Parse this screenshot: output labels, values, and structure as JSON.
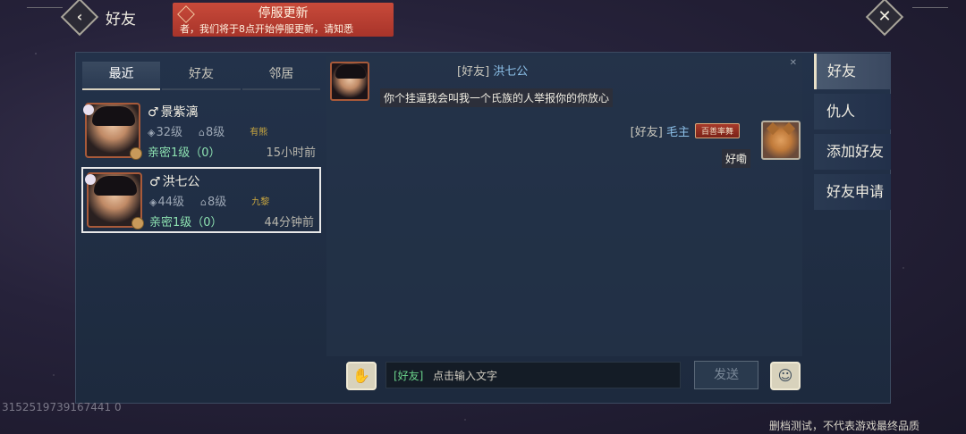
{
  "header": {
    "title": "好友"
  },
  "notice": {
    "title": "停服更新",
    "text": "者，我们将于8点开始停服更新，请知悉"
  },
  "tabs": [
    {
      "label": "最近"
    },
    {
      "label": "好友"
    },
    {
      "label": "邻居"
    }
  ],
  "friends": [
    {
      "name": "景紫漓",
      "gender": "♂",
      "level": "32级",
      "home_level": "8级",
      "badge": "有熊",
      "intimacy": "亲密1级（0）",
      "time": "15小时前"
    },
    {
      "name": "洪七公",
      "gender": "♂",
      "level": "44级",
      "home_level": "8级",
      "badge": "九黎",
      "intimacy": "亲密1级（0）",
      "time": "44分钟前"
    }
  ],
  "chat": {
    "messages": [
      {
        "tag": "[好友]",
        "name": "洪七公",
        "text": "你个挂逼我会叫我一个氏族的人举报你的你放心"
      },
      {
        "tag": "[好友]",
        "name": "毛主",
        "title_badge": "百善率舞",
        "text": "好嘞"
      }
    ]
  },
  "input": {
    "tag": "[好友]",
    "placeholder": "点击输入文字"
  },
  "send_label": "发送",
  "side_tabs": [
    {
      "label": "好友"
    },
    {
      "label": "仇人"
    },
    {
      "label": "添加好友"
    },
    {
      "label": "好友申请"
    }
  ],
  "watermark": "3152519739167441 0",
  "footer": "删档测试，不代表游戏最终品质",
  "colors": {
    "accent_green": "#8ce0b0",
    "name_blue": "#8cc0e8",
    "notice_red": "#b83c2e"
  },
  "icons": {
    "back": "chevron-left-icon",
    "close": "close-icon",
    "voice": "microphone-icon",
    "emoji": "smiley-icon"
  }
}
